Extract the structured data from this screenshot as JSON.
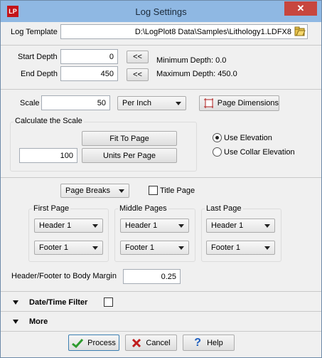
{
  "window": {
    "title": "Log Settings",
    "close": "✕"
  },
  "log_template": {
    "label": "Log Template",
    "value": "D:\\LogPlot8 Data\\Samples\\Lithology1.LDFX8"
  },
  "depth": {
    "start_label": "Start Depth",
    "start_value": "0",
    "end_label": "End Depth",
    "end_value": "450",
    "set_button": "<<",
    "min_label": "Minimum Depth: 0.0",
    "max_label": "Maximum Depth: 450.0"
  },
  "scale": {
    "label": "Scale",
    "value": "50",
    "unit": "Per Inch",
    "page_dimensions_button": "Page Dimensions",
    "calc_group_title": "Calculate the Scale",
    "fit_to_page_button": "Fit To Page",
    "units_value": "100",
    "units_per_page_button": "Units Per Page",
    "use_elevation": "Use Elevation",
    "use_collar_elevation": "Use Collar Elevation"
  },
  "pages": {
    "page_mode": "Page Breaks",
    "title_page": "Title Page",
    "first_page": {
      "title": "First Page",
      "header": "Header 1",
      "footer": "Footer 1"
    },
    "middle_pages": {
      "title": "Middle Pages",
      "header": "Header 1",
      "footer": "Footer 1"
    },
    "last_page": {
      "title": "Last Page",
      "header": "Header 1",
      "footer": "Footer 1"
    },
    "margin_label": "Header/Footer to Body Margin",
    "margin_value": "0.25"
  },
  "sections": {
    "date_time_filter": "Date/Time Filter",
    "more": "More"
  },
  "footer_buttons": {
    "process": "Process",
    "cancel": "Cancel",
    "help": "Help"
  },
  "colors": {
    "titlebar": "#8fb8e3",
    "close": "#c7463e",
    "process_check": "#2e9b2e",
    "cancel_x": "#c01b1b"
  }
}
